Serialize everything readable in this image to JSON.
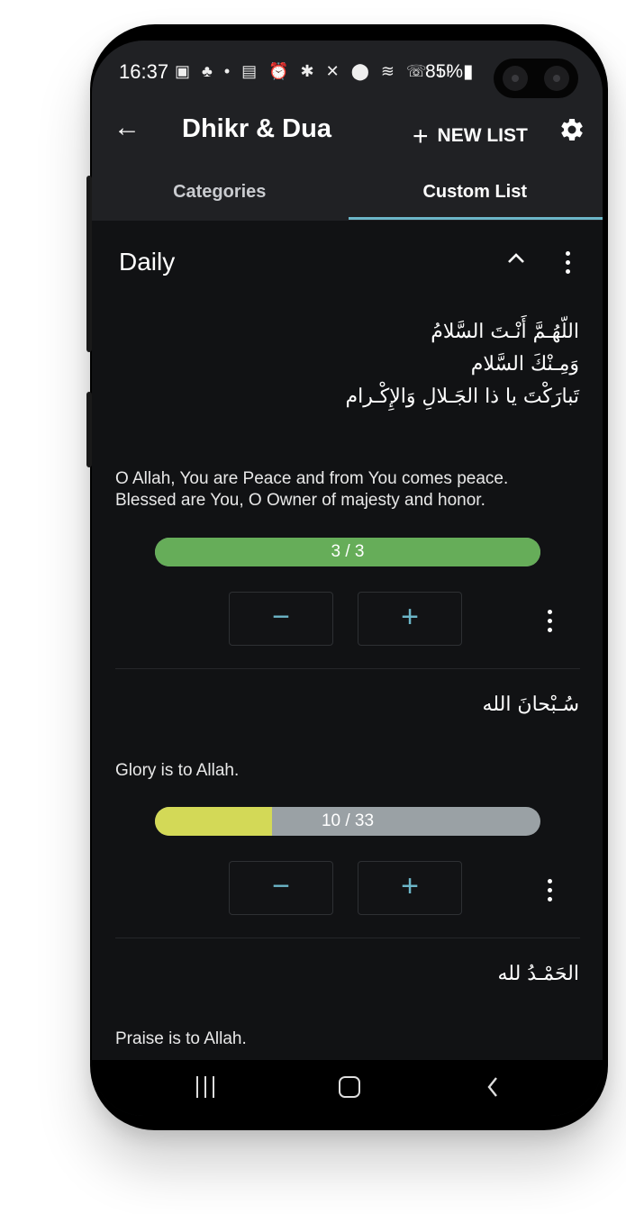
{
  "status_bar": {
    "time": "16:37",
    "indicator_icons": "▣ ♣ •  ▤ ⏰ ✱ ✕ ⬤ ≋ ☏ ıl",
    "battery": "85%▮"
  },
  "app_bar": {
    "title": "Dhikr & Dua",
    "new_list_label": "NEW LIST",
    "icons": [
      "back-arrow-icon",
      "plus-icon",
      "gear-icon"
    ]
  },
  "tabs": [
    {
      "label": "Categories",
      "selected": false
    },
    {
      "label": "Custom List",
      "selected": true
    }
  ],
  "list": {
    "title": "Daily",
    "items": [
      {
        "arabic": "اللّهُـمَّ أَنْـتَ السَّلامُ\nوَمِـنْكَ السَّلام\nتَبارَكْتَ يا ذا الجَـلالِ وَالإِكْـرام",
        "translation": "O Allah, You are Peace and from You comes peace.\nBlessed are You, O Owner of majesty and honor.",
        "progress_text": "3 / 3",
        "count": 3,
        "target": 3,
        "decrement_label": "−",
        "increment_label": "+"
      },
      {
        "arabic": "سُـبْحانَ الله",
        "translation": "Glory is to Allah.",
        "progress_text": "10 / 33",
        "count": 10,
        "target": 33,
        "decrement_label": "−",
        "increment_label": "+"
      },
      {
        "arabic": "الحَمْـدُ لله",
        "translation": "Praise is to Allah."
      }
    ]
  },
  "colors": {
    "complete": "#66ad59",
    "partial": "#d3d957",
    "track": "#9aa1a5",
    "accent": "#6cb6c8"
  }
}
